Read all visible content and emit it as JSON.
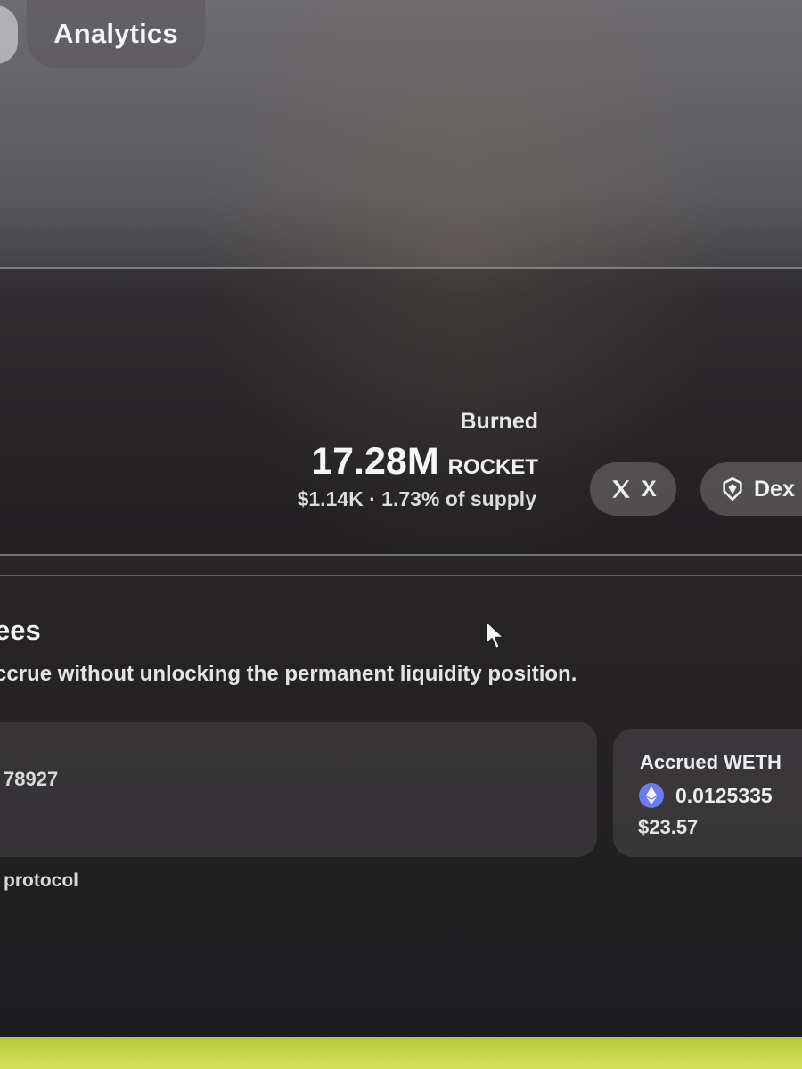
{
  "nav": {
    "analytics_label": "Analytics"
  },
  "burned": {
    "label": "Burned",
    "amount": "17.28M",
    "unit": "ROCKET",
    "usd_and_supply": "$1.14K · 1.73% of supply"
  },
  "links": {
    "x_label": "X",
    "dex_label": "Dex"
  },
  "fees": {
    "title": "ees",
    "description": "ccrue without unlocking the permanent liquidity position.",
    "position_id": "78927",
    "protocol": "protocol"
  },
  "accrued": {
    "title": "Accrued WETH",
    "amount": "0.0125335",
    "usd": "$23.57"
  },
  "colors": {
    "background": "#1c1b1d",
    "pill": "#787476",
    "eth_icon": "#6b7cf2",
    "bottom_strip": "#c9da4a"
  },
  "icons": [
    "x-logo-icon",
    "dexscreener-icon",
    "ethereum-icon",
    "mouse-cursor-icon"
  ]
}
